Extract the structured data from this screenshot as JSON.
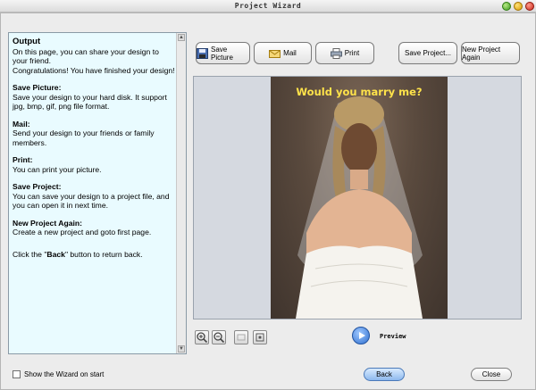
{
  "window": {
    "title": "Project Wizard"
  },
  "help": {
    "sections": [
      {
        "heading": "Output",
        "body": "On this page, you can share your design to your friend.\nCongratulations! You have finished your design!"
      },
      {
        "heading": "Save Picture:",
        "body": "Save your design to your hard disk. It support jpg, bmp, gif, png file format."
      },
      {
        "heading": "Mail:",
        "body": "Send your design to your friends or family members."
      },
      {
        "heading": "Print:",
        "body": "You can print your picture."
      },
      {
        "heading": "Save Project:",
        "body": "You can save your design to a project file, and you can open it in next time."
      },
      {
        "heading": "New Project Again:",
        "body": "Create a new project and goto first page."
      }
    ],
    "back_note_pre": "Click the \"",
    "back_note_bold": "Back",
    "back_note_post": "\" button to return back."
  },
  "toolbar": {
    "save_picture": "Save Picture",
    "mail": "Mail",
    "print": "Print",
    "save_project": "Save Project...",
    "new_project": "New Project Again"
  },
  "preview": {
    "caption": "Would you marry me?",
    "label": "Preview"
  },
  "footer": {
    "show_wizard_label": "Show the Wizard on start",
    "show_wizard_checked": false,
    "back": "Back",
    "close": "Close"
  },
  "colors": {
    "help_bg": "#e9fbff",
    "caption": "#ffe34a",
    "back_button": "#8db8ee",
    "preview_bg": "#d5d9e0"
  },
  "icons": [
    "save-picture-icon",
    "mail-icon",
    "print-icon",
    "zoom-in-icon",
    "zoom-out-icon",
    "fit-icon",
    "actual-size-icon",
    "play-icon"
  ]
}
